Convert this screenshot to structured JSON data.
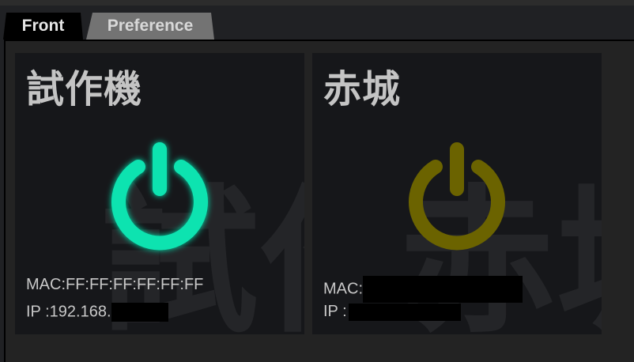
{
  "tabs": [
    {
      "label": "Front",
      "active": true
    },
    {
      "label": "Preference",
      "active": false
    }
  ],
  "devices": [
    {
      "name": "試作機",
      "mac_label": "MAC:",
      "mac": "FF:FF:FF:FF:FF:FF",
      "ip_label": "IP :",
      "ip": "192.168.",
      "power_state": "on",
      "power_color": "#0fe3b0",
      "ip_redacted": true,
      "mac_redacted": false
    },
    {
      "name": "赤城",
      "mac_label": "MAC:",
      "mac": "",
      "ip_label": "IP :",
      "ip": "",
      "power_state": "off",
      "power_color": "#6b6300",
      "ip_redacted": true,
      "mac_redacted": true
    }
  ],
  "icons": {
    "power": "power-icon"
  },
  "colors": {
    "background": "#202124",
    "card": "#16171a",
    "text": "#c8c8c8",
    "tab_active": "#000000",
    "tab_inactive": "#737373"
  }
}
